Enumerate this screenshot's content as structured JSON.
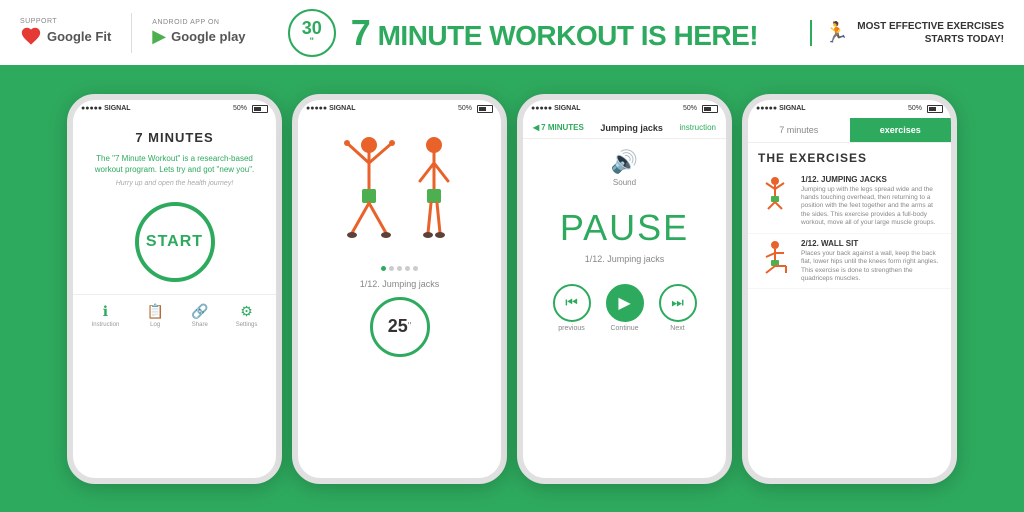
{
  "banner": {
    "support_label": "SUPPORT",
    "google_fit_text": "Google Fit",
    "android_label": "ANDROID APP ON",
    "google_play_text": "Google play",
    "thirty_badge": "30",
    "thirty_unit": "\"",
    "headline_seven": "7",
    "headline_main": "MINUTE WORKOUT IS HERE!",
    "most_effective_line1": "MOST EFFECTIVE EXERCISES",
    "most_effective_line2": "STARTS TODAY!"
  },
  "phone1": {
    "status_signal": "●●●●● SIGNAL",
    "status_battery": "50%",
    "title": "7 MINUTES",
    "description": "The \"7 Minute Workout\" is a research-based workout program. Lets try and got \"new you\".",
    "sub": "Hurry up and open the health journey!",
    "start_label": "START",
    "nav": [
      {
        "icon": "ℹ",
        "label": "Instruction"
      },
      {
        "icon": "📋",
        "label": "Log"
      },
      {
        "icon": "🔗",
        "label": "Share"
      },
      {
        "icon": "⚙",
        "label": "Settings"
      }
    ]
  },
  "phone2": {
    "status_signal": "●●●●● SIGNAL",
    "status_battery": "50%",
    "exercise_name": "1/12. Jumping jacks",
    "timer_value": "25",
    "timer_unit": "\""
  },
  "phone3": {
    "status_signal": "●●●●● SIGNAL",
    "status_battery": "50%",
    "back_label": "7 MINUTES",
    "ex_title": "Jumping jacks",
    "instruction_label": "instruction",
    "sound_label": "Sound",
    "pause_text": "PAUSE",
    "exercise_name": "1/12. Jumping jacks",
    "controls": [
      {
        "label": "previous"
      },
      {
        "label": "Continue"
      },
      {
        "label": "Next"
      }
    ]
  },
  "phone4": {
    "status_signal": "●●●●● SIGNAL",
    "status_battery": "50%",
    "tab1": "7 minutes",
    "tab2": "exercises",
    "section_title": "THE EXERCISES",
    "exercises": [
      {
        "num": "1/12.",
        "name": "JUMPING JACKS",
        "desc": "Jumping up with the legs spread wide and the hands touching overhead, then returning to a position with the feet together and the arms at the sides. This exercise provides a full-body workout, move all of your large muscle groups."
      },
      {
        "num": "2/12.",
        "name": "WALL SIT",
        "desc": "Places your back against a wall, keep the back flat, lower hips until the knees form right angles. This exercise is done to strengthen the quadriceps muscles."
      }
    ]
  }
}
